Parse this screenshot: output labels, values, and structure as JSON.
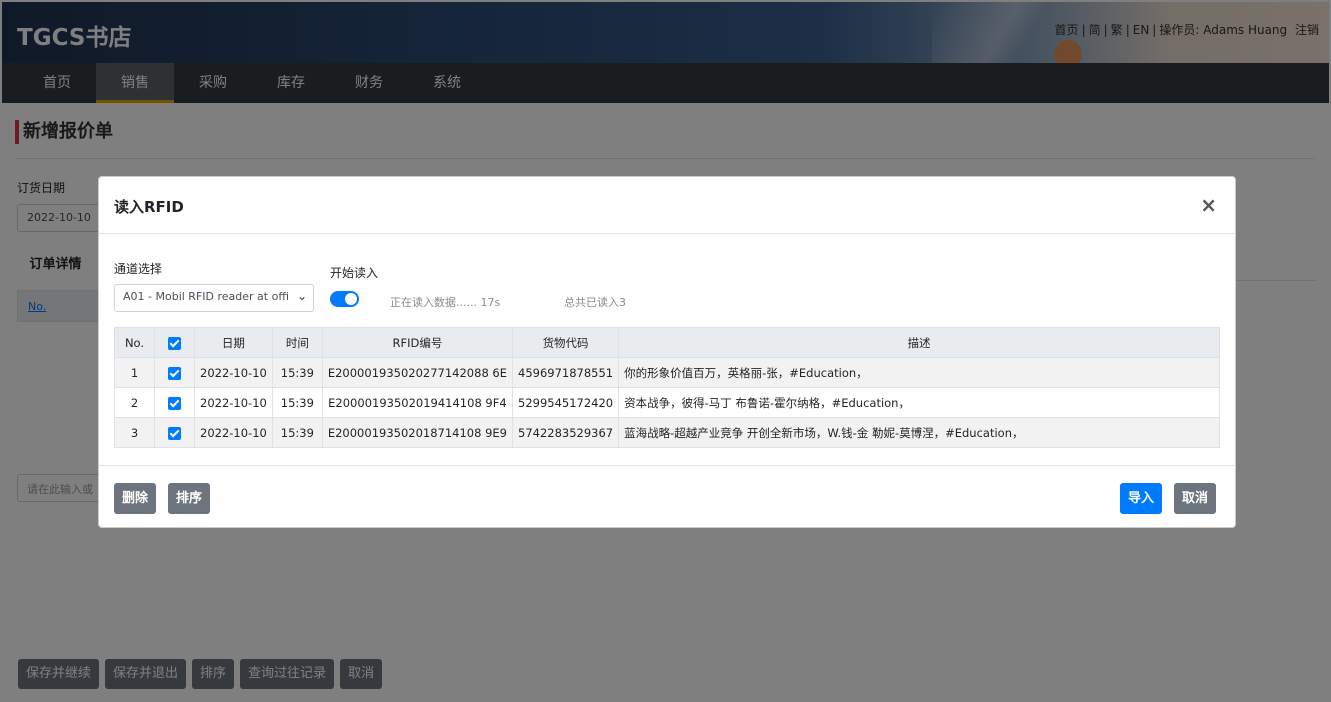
{
  "header": {
    "brand": "TGCS书店",
    "links": [
      "首页",
      "简",
      "繁",
      "EN"
    ],
    "operator_label": "操作员:",
    "operator_name": "Adams Huang",
    "logout": "注销"
  },
  "nav": {
    "items": [
      "首页",
      "销售",
      "采购",
      "库存",
      "财务",
      "系统"
    ],
    "active": "销售"
  },
  "page": {
    "title": "新增报价单",
    "order_date_label": "订货日期",
    "order_date_value": "2022-10-10",
    "tab_detail": "订单详情",
    "table_no": "No.",
    "search_placeholder": "请在此输入或",
    "buttons": [
      "保存并继续",
      "保存并退出",
      "排序",
      "查询过往记录",
      "取消"
    ]
  },
  "modal": {
    "title": "读入RFID",
    "close": "×",
    "channel_label": "通道选择",
    "channel_value": "A01 - Mobil RFID reader at offi",
    "start_label": "开始读入",
    "toggle_on": true,
    "reading_status": "正在读入数据...... 17s",
    "total_read": "总共已读入3",
    "columns": [
      "No.",
      "",
      "日期",
      "时间",
      "RFID编号",
      "货物代码",
      "描述"
    ],
    "rows": [
      {
        "no": "1",
        "checked": true,
        "date": "2022-10-10",
        "time": "15:39",
        "rfid": "E200001935020277142088 6E",
        "code": "4596971878551",
        "desc": "你的形象价值百万，英格丽-张，#Education，"
      },
      {
        "no": "2",
        "checked": true,
        "date": "2022-10-10",
        "time": "15:39",
        "rfid": "E20000193502019414108 9F4",
        "code": "5299545172420",
        "desc": "资本战争，彼得-马丁 布鲁诺-霍尔纳格，#Education，"
      },
      {
        "no": "3",
        "checked": true,
        "date": "2022-10-10",
        "time": "15:39",
        "rfid": "E20000193502018714108 9E9",
        "code": "5742283529367",
        "desc": "蓝海战略-超越产业竞争 开创全新市场，W.钱-金 勒妮-莫博涅，#Education，"
      }
    ],
    "footer": {
      "delete": "删除",
      "sort": "排序",
      "import": "导入",
      "cancel": "取消"
    }
  }
}
